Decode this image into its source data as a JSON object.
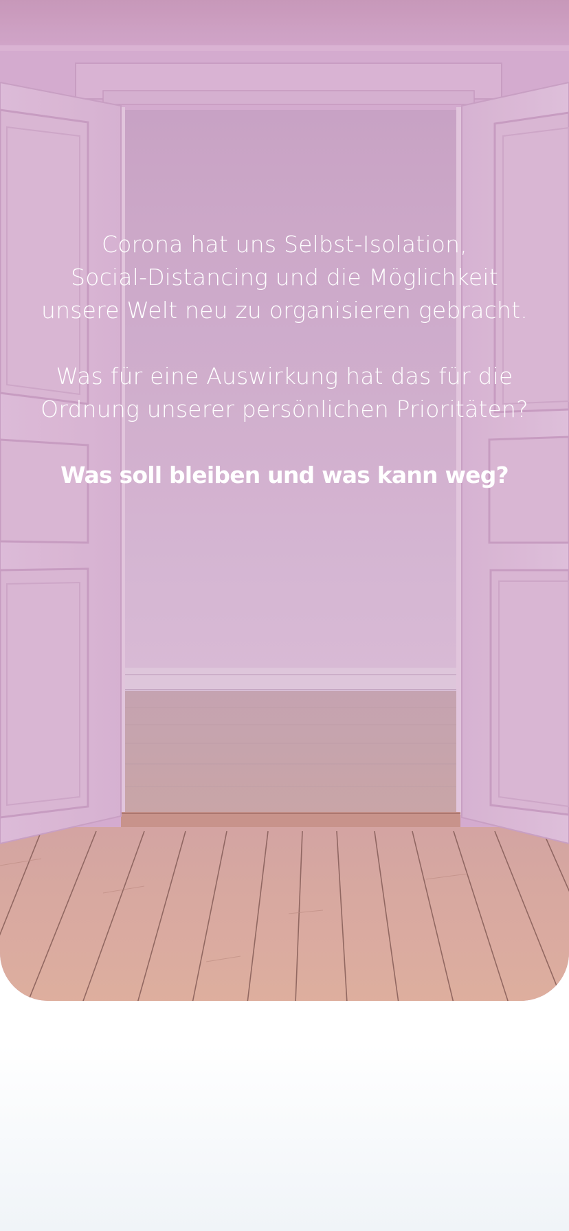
{
  "intro": {
    "lines_1": [
      "Corona hat uns Selbst-Isolation,",
      "Social-Distancing und die Möglichkeit",
      "unsere Welt neu zu organisieren gebracht."
    ],
    "lines_2": [
      "Was für eine Auswirkung hat das für die",
      "Ordnung unserer persönlichen Prioritäten?"
    ],
    "question": "Was soll bleiben und was kann weg?"
  },
  "theme": {
    "overlay_tint": "#d4afcd",
    "text_color": "#ffffff"
  }
}
